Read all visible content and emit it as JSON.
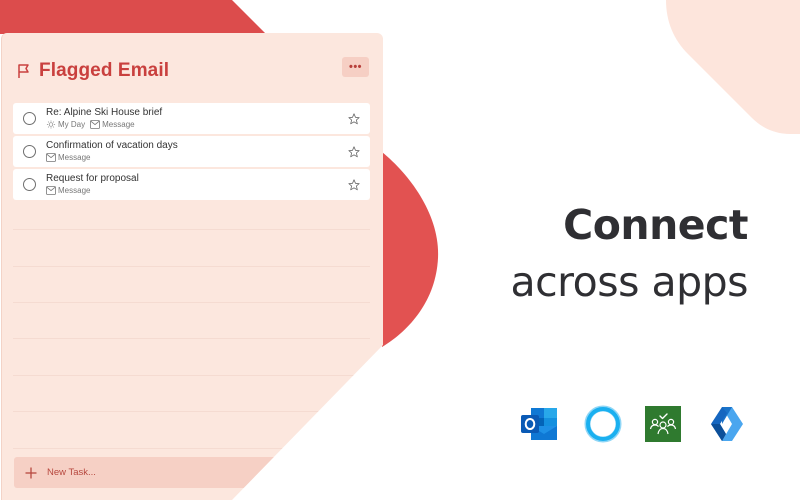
{
  "panel": {
    "title": "Flagged Email",
    "title_icon": "flag-icon",
    "more_label": "•••",
    "tasks": [
      {
        "title": "Re: Alpine Ski House brief",
        "meta": [
          {
            "icon": "sun-icon",
            "label": "My Day"
          },
          {
            "icon": "mail-icon",
            "label": "Message"
          }
        ],
        "starred": false
      },
      {
        "title": "Confirmation of vacation days",
        "meta": [
          {
            "icon": "mail-icon",
            "label": "Message"
          }
        ],
        "starred": false
      },
      {
        "title": "Request for proposal",
        "meta": [
          {
            "icon": "mail-icon",
            "label": "Message"
          }
        ],
        "starred": false
      }
    ],
    "new_task_label": "New Task..."
  },
  "headline": {
    "line1": "Connect",
    "line2": "across apps"
  },
  "apps": [
    {
      "name": "Outlook",
      "icon": "outlook-icon"
    },
    {
      "name": "Cortana",
      "icon": "cortana-icon"
    },
    {
      "name": "Teams Planner",
      "icon": "planner-icon"
    },
    {
      "name": "Launcher",
      "icon": "launcher-icon"
    }
  ],
  "colors": {
    "accent_red": "#e25251",
    "panel_bg": "#fce7de",
    "title_red": "#c9403e",
    "blob_peach": "#fde5dc"
  }
}
